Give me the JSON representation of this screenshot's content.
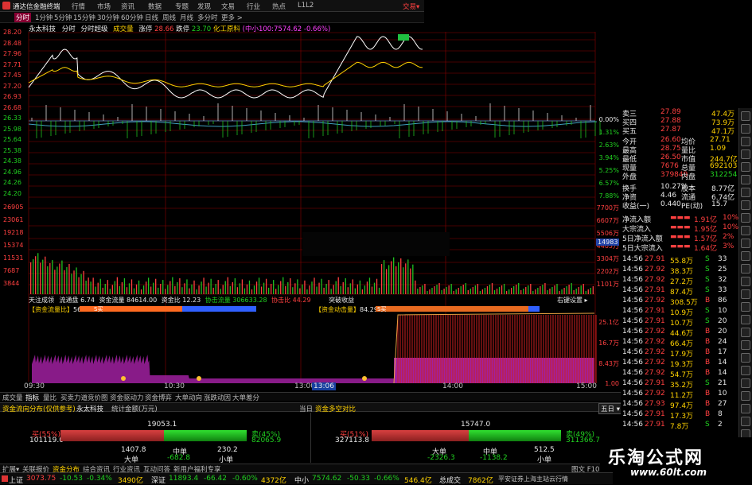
{
  "app": {
    "title": "通达信金融终端",
    "trade_btn": "交易▾"
  },
  "menu": [
    "行情",
    "市场",
    "资讯",
    "数据",
    "专题",
    "发现",
    "文易",
    "行业",
    "热点",
    "L1L2"
  ],
  "periods": [
    "分时",
    "1分钟",
    "5分钟",
    "15分钟",
    "30分钟",
    "60分钟",
    "日线",
    "周线",
    "月线",
    "多分时",
    "更多 >"
  ],
  "chart_header": {
    "stock": "永太科技",
    "mode": "分时",
    "mode2": "分时超级",
    "vol_label": "成交量",
    "change_label": "涨停",
    "change_val": "28.66",
    "limit_label": "跌停",
    "limit_val": "23.70",
    "sector": "化工原料",
    "index": "(中小100:7574.62 -0.66%)"
  },
  "price_axis": [
    "28.20",
    "28.48",
    "27.96",
    "27.71",
    "27.45",
    "27.20",
    "26.93",
    "26.68",
    "26.33",
    "25.98",
    "25.64",
    "25.38",
    "24.38",
    "24.96",
    "24.26",
    "24.20"
  ],
  "pct_axis": [
    "0.00%",
    "1.31%",
    "2.63%",
    "3.94%",
    "5.25%",
    "6.57%",
    "7.88%"
  ],
  "vol_axis_left": [
    "26905",
    "23061",
    "19218",
    "15374",
    "11531",
    "7687",
    "3844"
  ],
  "vol_axis_right": [
    "7700万",
    "6607万",
    "5506万",
    "4405万",
    "3304万",
    "2202万",
    "1101万"
  ],
  "vol_marker": "14983",
  "flow_header": {
    "label1": "天注成领",
    "a": "流通盘",
    "a_val": "6.74",
    "b": "资金流量",
    "b_val": "84614.00",
    "c": "资金比",
    "c_val": "12.23",
    "d": "协击流量",
    "d_val": "306633.28",
    "e": "协击比",
    "e_val": "44.29",
    "f": "突破收益",
    "g": "右键设置 ▸"
  },
  "flow_left": {
    "label": "【资金流量比】",
    "val": "56.11",
    "mark": "S买"
  },
  "flow_right": {
    "label": "【资金动击量】",
    "val": "84.29",
    "mark": "S买"
  },
  "flow_axis": [
    "25.1亿",
    "16.7万",
    "8.43万",
    "1.00"
  ],
  "time_axis": [
    "09:30",
    "10:30",
    "13:00",
    "13:06",
    "14:00",
    "15:00"
  ],
  "bottom_tabs": [
    "成交量",
    "指标",
    "量比",
    "买卖力道",
    "竞价图",
    "资金驱动力",
    "资金博弈",
    "大单动向",
    "涨跌动因",
    "大单差分"
  ],
  "bottom_panel": {
    "left_title": "资金流向分布(仅供参考)",
    "left_stock": "永太科技",
    "left_sub": "统计金额(万元)",
    "mid": "当日",
    "right_title": "资金多空对比",
    "right_tag": "五日 ▾",
    "left": {
      "total": "19053.1",
      "buy_label": "买(55%)",
      "buy_val": "101119.0",
      "sell_label": "卖(45%)",
      "sell_val": "82065.9",
      "big": "大单",
      "big_val": "1407.8",
      "mid": "中单",
      "mid_val": "230.2",
      "small": "小单",
      "big2": "-682.8"
    },
    "right": {
      "total": "15747.0",
      "buy_label": "买(51%)",
      "buy_val": "327113.8",
      "sell_label": "卖(49%)",
      "sell_val": "311366.7",
      "big": "大单",
      "big_val": "-2326.3",
      "mid": "中单",
      "mid_val": "-1138.2",
      "small": "小单",
      "small_val": "512.5"
    }
  },
  "bottom_nav": [
    "扩展▾",
    "关联报价",
    "资金分布",
    "综合资讯",
    "行业资讯",
    "互动问答",
    "新用户福利专享"
  ],
  "bottom_nav_right": "图文 F10",
  "quote": {
    "top": [
      {
        "l": "卖三",
        "p": "27.89",
        "v": "47.4万"
      },
      {
        "l": "买四",
        "p": "27.88",
        "v": "73.9万"
      },
      {
        "l": "买五",
        "p": "27.87",
        "v": "47.1万"
      }
    ],
    "stats": [
      {
        "a": "今开",
        "b": "26.60",
        "c": "均价",
        "d": "27.71"
      },
      {
        "a": "最高",
        "b": "28.75",
        "c": "量比",
        "d": "1.09"
      },
      {
        "a": "最低",
        "b": "26.50",
        "c": "市值",
        "d": "244.7亿"
      },
      {
        "a": "现量",
        "b": "7676",
        "c": "总量",
        "d": "692103"
      },
      {
        "a": "外盘",
        "b": "379849",
        "c": "内盘",
        "d": "312254"
      }
    ],
    "stats2": [
      {
        "a": "换手",
        "b": "10.27%",
        "c": "股本",
        "d": "8.77亿"
      },
      {
        "a": "净资",
        "b": "4.46",
        "c": "流通",
        "d": "6.74亿"
      },
      {
        "a": "收益(一)",
        "b": "0.440",
        "c": "PE(动)",
        "d": "15.7"
      }
    ],
    "flows": [
      {
        "l": "净流入额",
        "v": "1.91亿",
        "p": "10%"
      },
      {
        "l": "大宗流入",
        "v": "1.95亿",
        "p": "10%"
      },
      {
        "l": "5日净流入额",
        "v": "1.57亿",
        "p": "2%"
      },
      {
        "l": "5日大宗流入",
        "v": "1.64亿",
        "p": "3%"
      }
    ],
    "ticks": [
      [
        "14:56",
        "27.91",
        "55.8万",
        "S",
        "33"
      ],
      [
        "14:56",
        "27.92",
        "38.3万",
        "S",
        "25"
      ],
      [
        "14:56",
        "27.92",
        "27.2万",
        "S",
        "32"
      ],
      [
        "14:56",
        "27.91",
        "87.4万",
        "S",
        "33"
      ],
      [
        "14:56",
        "27.92",
        "308.5万",
        "B",
        "86"
      ],
      [
        "14:56",
        "27.91",
        "10.9万",
        "S",
        "10"
      ],
      [
        "14:56",
        "27.91",
        "10.7万",
        "S",
        "20"
      ],
      [
        "14:56",
        "27.92",
        "44.6万",
        "B",
        "20"
      ],
      [
        "14:56",
        "27.92",
        "66.4万",
        "B",
        "24"
      ],
      [
        "14:56",
        "27.92",
        "17.9万",
        "B",
        "17"
      ],
      [
        "14:56",
        "27.92",
        "19.3万",
        "B",
        "14"
      ],
      [
        "14:56",
        "27.92",
        "54.7万",
        "B",
        "14"
      ],
      [
        "14:56",
        "27.91",
        "35.2万",
        "S",
        "21"
      ],
      [
        "14:56",
        "27.92",
        "11.2万",
        "B",
        "10"
      ],
      [
        "14:56",
        "27.93",
        "97.4万",
        "B",
        "27"
      ],
      [
        "14:56",
        "27.91",
        "17.3万",
        "B",
        "8"
      ],
      [
        "14:56",
        "27.91",
        "7.8万",
        "S",
        "2"
      ]
    ]
  },
  "watermark": {
    "title": "乐淘公式网",
    "url": "www.60lt.com"
  },
  "status": {
    "sh_label": "上证",
    "sh_val": "3073.75",
    "sh_chg": "-10.53",
    "sh_pct": "-0.34%",
    "sh_amt": "3490亿",
    "sz_label": "深证",
    "sz_val": "11893.4",
    "sz_chg": "-66.42",
    "sz_pct": "-0.60%",
    "sz_amt": "4372亿",
    "zx_label": "中小",
    "zx_val": "7574.62",
    "zx_chg": "-50.33",
    "zx_pct": "-0.66%",
    "zx_amt": "546.4亿",
    "total_label": "总成交",
    "total_val": "7862亿",
    "broker": "平安证券上海主站云行情"
  },
  "colors": {
    "up": "#ff4040",
    "down": "#20d020",
    "grid": "#8b0000",
    "price_line": "#ffffff",
    "avg_line": "#ffd200"
  }
}
